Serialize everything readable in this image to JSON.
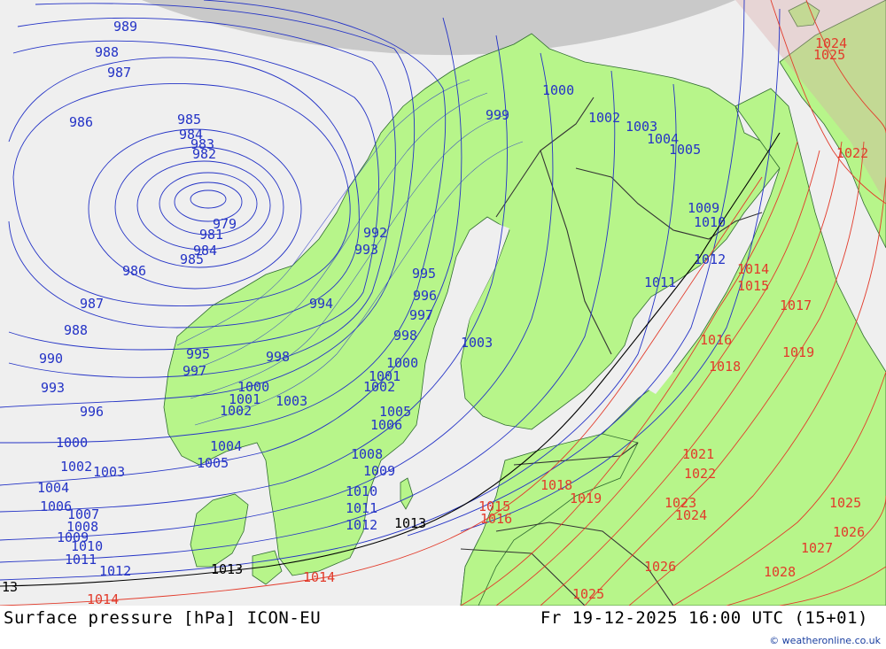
{
  "footer": {
    "title": "Surface pressure [hPa] ICON-EU",
    "datetime": "Fr 19-12-2025 16:00 UTC (15+01)",
    "credit": "© weatheronline.co.uk"
  },
  "colors": {
    "sea": "#efefef",
    "land": "#b7f58a",
    "ice": "#c9c9c9",
    "isobar_low": "#2433c6",
    "isobar_high": "#e23b2b",
    "isobar_1013": "#000000",
    "border": "#333333"
  },
  "labels": {
    "l989": "989",
    "l988": "988",
    "l987a": "987",
    "l986a": "986",
    "l985a": "985",
    "l984": "984",
    "l983": "983",
    "l982": "982",
    "l979": "979",
    "l981": "981",
    "l984b": "984",
    "l985b": "985",
    "l986b": "986",
    "l987b": "987",
    "l988b": "988",
    "l990": "990",
    "l993": "993",
    "l996": "996",
    "l1000": "1000",
    "l1002": "1002",
    "l1003": "1003",
    "l1004": "1004",
    "l1006": "1006",
    "l1007": "1007",
    "l1008": "1008",
    "l1009": "1009",
    "l1010": "1010",
    "l1011": "1011",
    "l1012": "1012",
    "l1013a": "1013",
    "l1013b": "1013",
    "l1013c": "13",
    "l1014": "1014",
    "l1014b": "1014",
    "n999": "999",
    "n1000": "1000",
    "n1002": "1002",
    "n1003": "1003",
    "n1004": "1004",
    "n1005": "1005",
    "n1009": "1009",
    "n1010": "1010",
    "n1012": "1012",
    "n1011": "1011",
    "s992": "992",
    "s993": "993",
    "s995": "995",
    "s996": "996",
    "s997": "997",
    "s998": "998",
    "s1000": "1000",
    "s1001": "1001",
    "s1002": "1002",
    "s1003": "1003",
    "s1005": "1005",
    "s1006": "1006",
    "s1008": "1008",
    "s1009": "1009",
    "s1010": "1010",
    "s1011": "1011",
    "s1012": "1012",
    "s1013": "1013",
    "w994": "994",
    "w995": "995",
    "w997": "997",
    "w998": "998",
    "w1000": "1000",
    "w1001": "1001",
    "w1002": "1002",
    "w1003": "1003",
    "w1004": "1004",
    "w1005": "1005",
    "r1014": "1014",
    "r1015": "1015",
    "r1016": "1016",
    "r1017": "1017",
    "r1018": "1018",
    "r1019": "1019",
    "r1021": "1021",
    "r1022": "1022",
    "r1023": "1023",
    "r1024": "1024",
    "r1025": "1025",
    "r1026": "1026",
    "r1027": "1027",
    "r1028": "1028",
    "r1015b": "1015",
    "r1016b": "1016",
    "r1018b": "1018",
    "r1019b": "1019",
    "r1024b": "1024",
    "r1025b": "1025",
    "r1022b": "1022",
    "r1025c": "1025",
    "r1026b": "1026"
  }
}
